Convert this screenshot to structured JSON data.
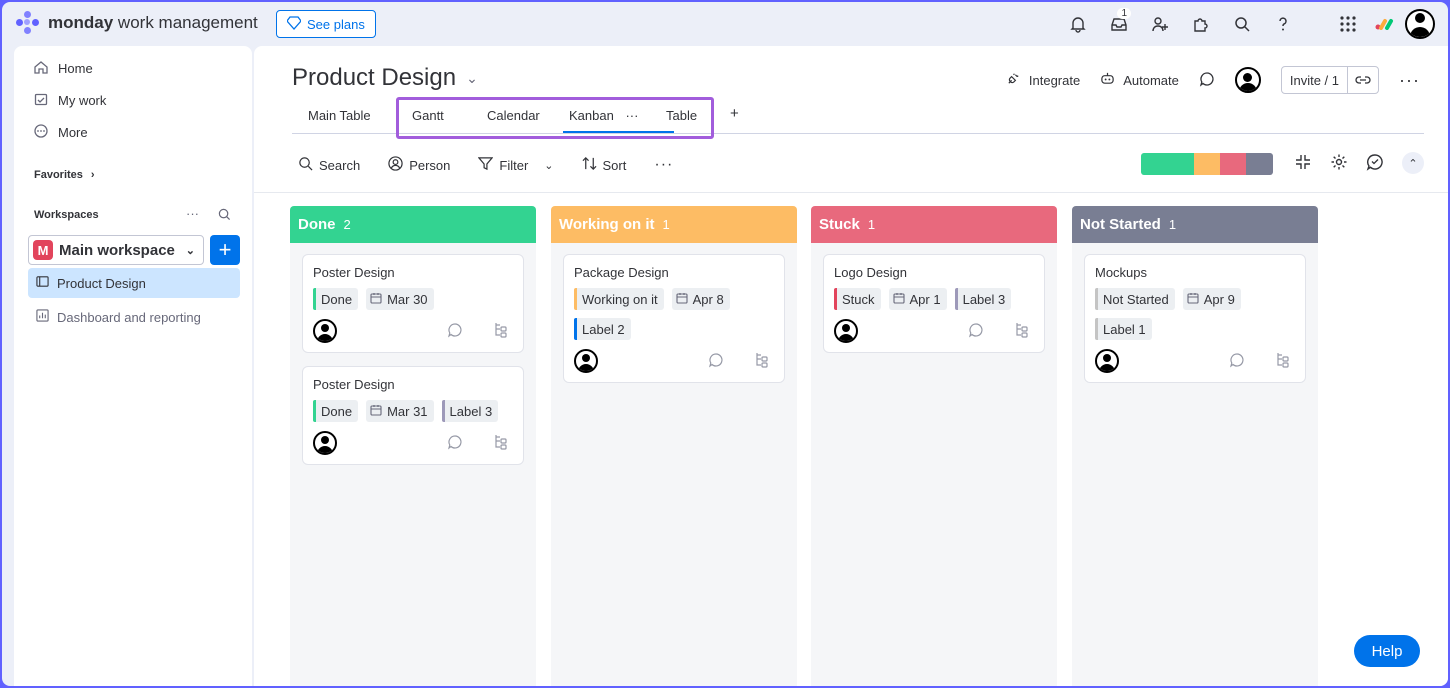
{
  "app": {
    "brand_bold": "monday",
    "brand_rest": "work management",
    "see_plans": "See plans",
    "inbox_badge": "1"
  },
  "sidebar": {
    "nav": [
      {
        "label": "Home",
        "icon": "home-icon"
      },
      {
        "label": "My work",
        "icon": "calendar-check-icon"
      },
      {
        "label": "More",
        "icon": "more-circle-icon"
      }
    ],
    "favorites": "Favorites",
    "workspaces": "Workspaces",
    "workspace_badge": "M",
    "workspace_name": "Main workspace",
    "boards": [
      {
        "label": "Product Design",
        "icon": "board-icon"
      },
      {
        "label": "Dashboard and reporting",
        "icon": "dashboard-icon"
      }
    ]
  },
  "board": {
    "title": "Product Design",
    "integrate": "Integrate",
    "automate": "Automate",
    "invite": "Invite / 1",
    "tabs": [
      "Main Table",
      "Gantt",
      "Calendar",
      "Kanban",
      "Table"
    ],
    "active_tab": "Kanban",
    "add_tab": "+",
    "toolbar": {
      "search": "Search",
      "person": "Person",
      "filter": "Filter",
      "sort": "Sort"
    },
    "status_summary_colors": [
      "#33d391",
      "#fdbc64",
      "#e8697d",
      "#797e93"
    ]
  },
  "columns": [
    {
      "title": "Done",
      "count": "2",
      "color": "#33d391",
      "cards": [
        {
          "title": "Poster Design",
          "tags": [
            {
              "text": "Done",
              "color": "#33d391"
            },
            {
              "text": "Mar 30",
              "date": true
            }
          ]
        },
        {
          "title": "Poster Design",
          "tags": [
            {
              "text": "Done",
              "color": "#33d391"
            },
            {
              "text": "Mar 31",
              "date": true
            },
            {
              "text": "Label 3",
              "color": "#9d99b9"
            }
          ]
        }
      ]
    },
    {
      "title": "Working on it",
      "count": "1",
      "color": "#fdbc64",
      "cards": [
        {
          "title": "Package Design",
          "tags": [
            {
              "text": "Working on it",
              "color": "#fdbc64"
            },
            {
              "text": "Apr 8",
              "date": true
            },
            {
              "text": "Label 2",
              "color": "#0073ea"
            }
          ]
        }
      ]
    },
    {
      "title": "Stuck",
      "count": "1",
      "color": "#e8697d",
      "cards": [
        {
          "title": "Logo Design",
          "tags": [
            {
              "text": "Stuck",
              "color": "#e2445c"
            },
            {
              "text": "Apr 1",
              "date": true
            },
            {
              "text": "Label 3",
              "color": "#9d99b9"
            }
          ]
        }
      ]
    },
    {
      "title": "Not Started",
      "count": "1",
      "color": "#797e93",
      "cards": [
        {
          "title": "Mockups",
          "tags": [
            {
              "text": "Not Started",
              "color": "#c4c4c4"
            },
            {
              "text": "Apr 9",
              "date": true
            },
            {
              "text": "Label 1",
              "color": "#c4c4c4"
            }
          ]
        }
      ]
    }
  ],
  "help": "Help"
}
